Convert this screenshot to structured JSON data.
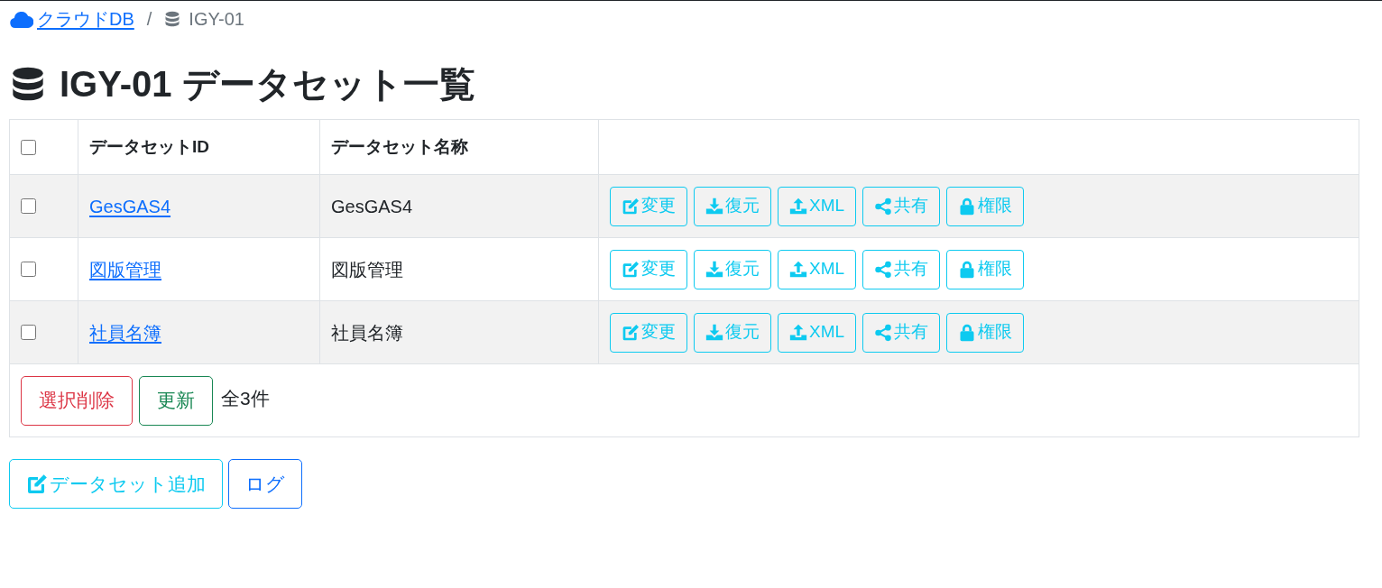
{
  "breadcrumb": [
    {
      "kind": "link",
      "label": "クラウドDB"
    },
    {
      "kind": "current",
      "label": "IGY-01"
    }
  ],
  "breadcrumb_separator": "/",
  "heading": "IGY-01 データセット一覧",
  "table": {
    "select_all": {
      "checked": false
    },
    "columns": [
      "データセットID",
      "データセット名称"
    ],
    "rows": [
      {
        "checked": false,
        "id": "GesGAS4",
        "name": "GesGAS4",
        "actions": [
          {
            "kind": "edit",
            "label": "変更"
          },
          {
            "kind": "download",
            "label": "復元"
          },
          {
            "kind": "upload",
            "label": "XML"
          },
          {
            "kind": "share",
            "label": "共有"
          },
          {
            "kind": "lock",
            "label": "権限"
          }
        ]
      },
      {
        "checked": false,
        "id": "図版管理",
        "name": "図版管理",
        "actions": [
          {
            "kind": "edit",
            "label": "変更"
          },
          {
            "kind": "download",
            "label": "復元"
          },
          {
            "kind": "upload",
            "label": "XML"
          },
          {
            "kind": "share",
            "label": "共有"
          },
          {
            "kind": "lock",
            "label": "権限"
          }
        ]
      },
      {
        "checked": false,
        "id": "社員名簿",
        "name": "社員名簿",
        "actions": [
          {
            "kind": "edit",
            "label": "変更"
          },
          {
            "kind": "download",
            "label": "復元"
          },
          {
            "kind": "upload",
            "label": "XML"
          },
          {
            "kind": "share",
            "label": "共有"
          },
          {
            "kind": "lock",
            "label": "権限"
          }
        ]
      }
    ],
    "footer": {
      "buttons": [
        {
          "kind": "delete",
          "label": "選択削除"
        },
        {
          "kind": "refresh",
          "label": "更新"
        }
      ],
      "count": "全3件"
    }
  },
  "actions": [
    {
      "kind": "add",
      "label": "データセット追加"
    },
    {
      "kind": "log",
      "label": "ログ"
    }
  ]
}
